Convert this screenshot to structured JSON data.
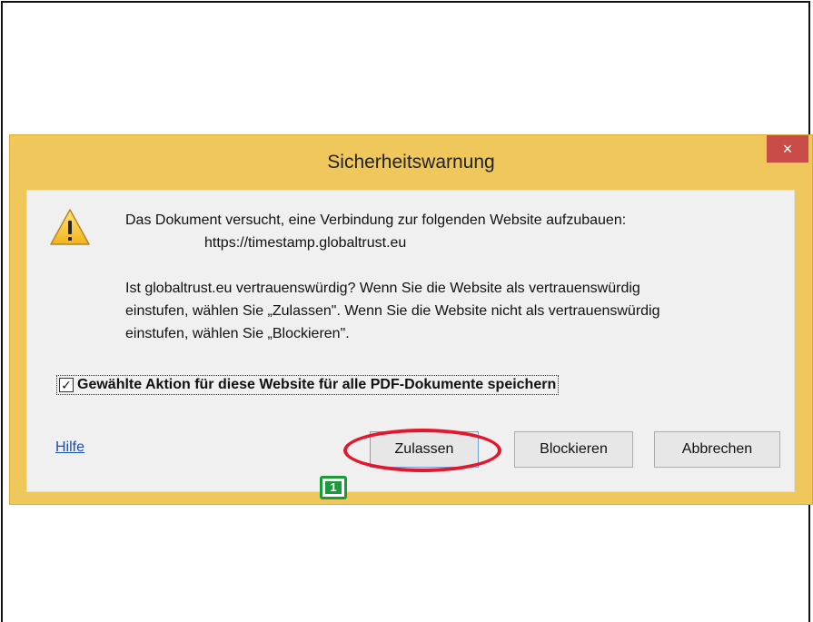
{
  "dialog": {
    "title": "Sicherheitswarnung",
    "close_glyph": "×",
    "icon": "warning-triangle-icon",
    "message_line1": "Das Dokument versucht, eine Verbindung zur folgenden Website aufzubauen:",
    "url": "https://timestamp.globaltrust.eu",
    "question_line1": "Ist globaltrust.eu vertrauenswürdig? Wenn Sie die Website als vertrauenswürdig",
    "question_line2": "einstufen, wählen Sie „Zulassen\". Wenn Sie die Website nicht als vertrauenswürdig",
    "question_line3": "einstufen, wählen Sie „Blockieren\".",
    "save_checkbox": {
      "checked": true,
      "check_glyph": "✓",
      "label": "Gewählte Aktion für diese Website für alle PDF-Dokumente speichern"
    },
    "help_link": "Hilfe",
    "buttons": {
      "allow": "Zulassen",
      "block": "Blockieren",
      "cancel": "Abbrechen"
    }
  },
  "annotation": {
    "step_number": "1",
    "highlight_color": "#e3162b",
    "badge_color": "#1a9a3a"
  },
  "colors": {
    "frame_accent": "#f0c75a",
    "close_button": "#c94c48",
    "link": "#1a4fb4"
  }
}
